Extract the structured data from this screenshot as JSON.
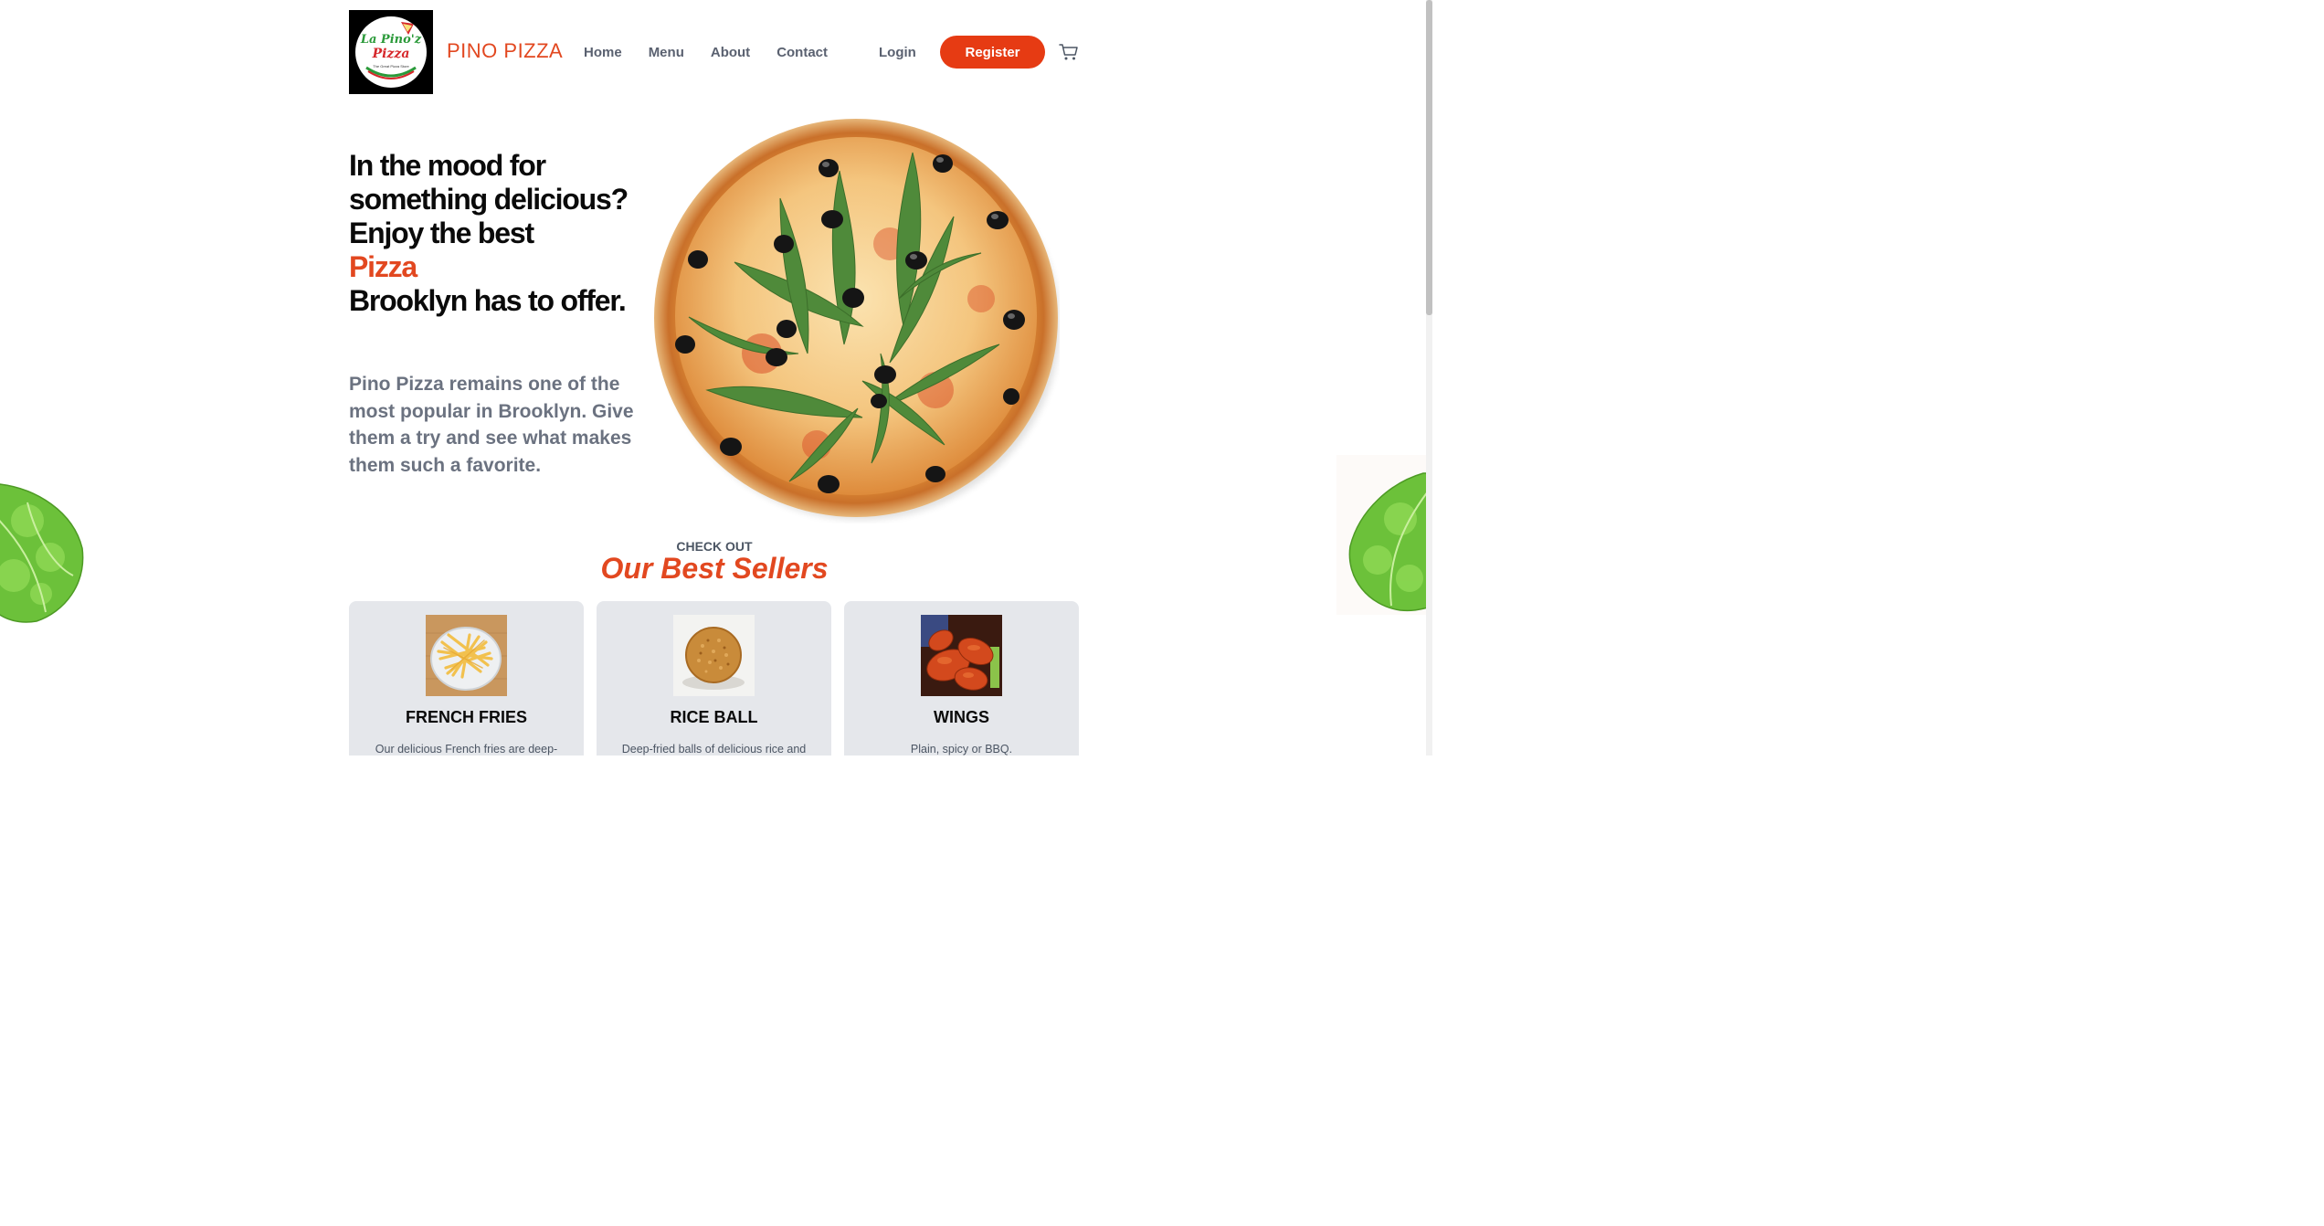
{
  "header": {
    "logo_line1": "La Pino'z",
    "logo_line2": "Pizza",
    "logo_tagline": "The Great Pizza Store",
    "brand": "PINO PIZZA",
    "nav": [
      "Home",
      "Menu",
      "About",
      "Contact"
    ],
    "login": "Login",
    "register": "Register",
    "cart_icon": "shopping-cart-icon"
  },
  "hero": {
    "title_lines": [
      "In the mood for",
      "something delicious?",
      "Enjoy the best"
    ],
    "title_accent": "Pizza",
    "title_end": "Brooklyn has to offer.",
    "description": "Pino Pizza remains one of the most popular in Brooklyn. Give them a try and see what makes them such a favorite."
  },
  "best_sellers": {
    "kicker": "CHECK OUT",
    "title": "Our Best Sellers",
    "items": [
      {
        "name": "FRENCH FRIES",
        "description": "Our delicious French fries are deep-"
      },
      {
        "name": "RICE BALL",
        "description": "Deep-fried balls of delicious rice and"
      },
      {
        "name": "WINGS",
        "description": "Plain, spicy or BBQ."
      }
    ]
  },
  "colors": {
    "accent": "#e24820",
    "button": "#e63b13",
    "muted_text": "#6b7280",
    "card_bg": "#e5e7eb"
  }
}
